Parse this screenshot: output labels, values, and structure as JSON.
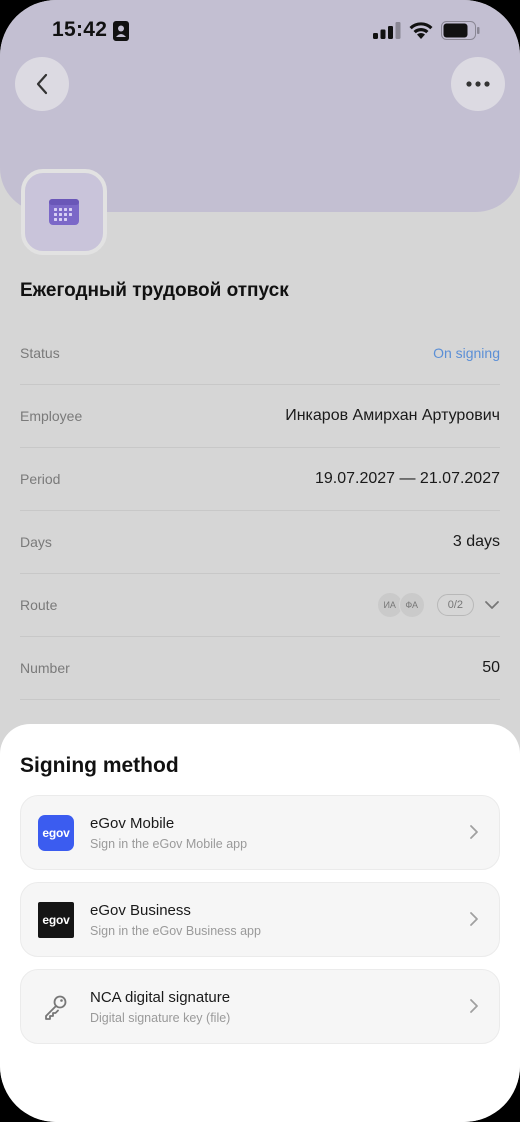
{
  "status_bar": {
    "time": "15:42"
  },
  "document": {
    "title": "Ежегодный трудовой отпуск"
  },
  "details": {
    "status": {
      "label": "Status",
      "value": "On signing"
    },
    "employee": {
      "label": "Employee",
      "value": "Инкаров Амирхан Артурович"
    },
    "period": {
      "label": "Period",
      "value": "19.07.2027 — 21.07.2027"
    },
    "days": {
      "label": "Days",
      "value": "3 days"
    },
    "route": {
      "label": "Route",
      "avatars": [
        "ИА",
        "ФА"
      ],
      "progress": "0/2"
    },
    "number": {
      "label": "Number",
      "value": "50"
    }
  },
  "signing_sheet": {
    "title": "Signing method",
    "options": [
      {
        "title": "eGov Mobile",
        "subtitle": "Sign in the eGov Mobile app",
        "logo": "egov"
      },
      {
        "title": "eGov Business",
        "subtitle": "Sign in the eGov Business app",
        "logo": "egov"
      },
      {
        "title": "NCA digital signature",
        "subtitle": "Digital signature key (file)",
        "icon": "key-icon"
      }
    ]
  },
  "colors": {
    "header": "#c3bfd2",
    "accent_purple": "#7b68c8",
    "status_blue": "#5b8fd6",
    "egov_mobile_blue": "#3b5cf0"
  }
}
